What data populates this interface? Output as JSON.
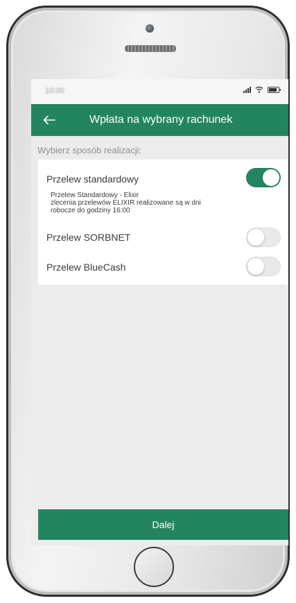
{
  "status_bar": {
    "time": "10:00"
  },
  "header": {
    "title": "Wpłata na wybrany rachunek",
    "back_icon": "arrow-left-icon"
  },
  "section_label": "Wybierz sposób realizacji:",
  "options": [
    {
      "label": "Przelew standardowy",
      "enabled": true,
      "description": [
        "Przelew Standardowy - Elixir",
        "zlecenia przelewów ELIXIR realizowane są w dni",
        "robocze do godziny 16:00"
      ]
    },
    {
      "label": "Przelew SORBNET",
      "enabled": false
    },
    {
      "label": "Przelew BlueCash",
      "enabled": false
    }
  ],
  "footer": {
    "next_label": "Dalej"
  },
  "colors": {
    "accent": "#238560",
    "background": "#ececec",
    "card": "#ffffff",
    "text": "#3a3a3a",
    "muted": "#8f8f8f"
  }
}
